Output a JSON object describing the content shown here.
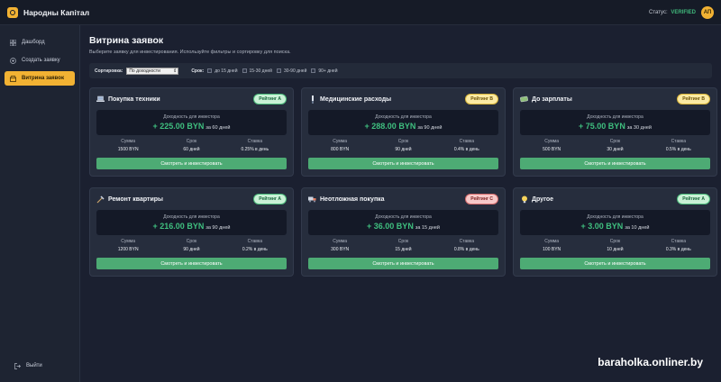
{
  "app": {
    "brand": "Народны Капітал",
    "status_label": "Статус:",
    "status_value": "VERIFIED",
    "avatar_initials": "АП",
    "accent_color": "#f2b233"
  },
  "sidebar": {
    "items": [
      {
        "label": "Дашборд",
        "icon": "grid-icon"
      },
      {
        "label": "Создать заявку",
        "icon": "plus-circle-icon"
      },
      {
        "label": "Витрина заявок",
        "icon": "storefront-icon",
        "active": true
      }
    ],
    "logout_label": "Выйти"
  },
  "page": {
    "title": "Витрина заявок",
    "subtitle": "Выберите заявку для инвестирования. Используйте фильтры и сортировку для поиска."
  },
  "filters": {
    "sort_label": "Сортировка:",
    "sort_value": "По доходности",
    "term_label": "Срок:",
    "term_options": [
      "до 15 дней",
      "15-30 дней",
      "30-90 дней",
      "90+ дней"
    ]
  },
  "cards": [
    {
      "title": "Покупка техники",
      "icon": "laptop-icon",
      "rating": "Рейтинг A",
      "yield_label": "Доходность для инвестора",
      "yield_amount": "+ 225.00 BYN",
      "yield_term": "за 60 дней",
      "sum_label": "Сумма",
      "sum": "1500 BYN",
      "term_label": "Срок",
      "term": "60 дней",
      "rate_label": "Ставка",
      "rate": "0.25% в день",
      "cta": "Смотреть и инвестировать"
    },
    {
      "title": "Медицинские расходы",
      "icon": "medical-icon",
      "rating": "Рейтинг B",
      "yield_label": "Доходность для инвестора",
      "yield_amount": "+ 288.00 BYN",
      "yield_term": "за 90 дней",
      "sum_label": "Сумма",
      "sum": "800 BYN",
      "term_label": "Срок",
      "term": "90 дней",
      "rate_label": "Ставка",
      "rate": "0.4% в день",
      "cta": "Смотреть и инвестировать"
    },
    {
      "title": "До зарплаты",
      "icon": "money-icon",
      "rating": "Рейтинг B",
      "yield_label": "Доходность для инвестора",
      "yield_amount": "+ 75.00 BYN",
      "yield_term": "за 30 дней",
      "sum_label": "Сумма",
      "sum": "500 BYN",
      "term_label": "Срок",
      "term": "30 дней",
      "rate_label": "Ставка",
      "rate": "0.5% в день",
      "cta": "Смотреть и инвестировать"
    },
    {
      "title": "Ремонт квартиры",
      "icon": "tools-icon",
      "rating": "Рейтинг A",
      "yield_label": "Доходность для инвестора",
      "yield_amount": "+ 216.00 BYN",
      "yield_term": "за 90 дней",
      "sum_label": "Сумма",
      "sum": "1200 BYN",
      "term_label": "Срок",
      "term": "90 дней",
      "rate_label": "Ставка",
      "rate": "0.2% в день",
      "cta": "Смотреть и инвестировать"
    },
    {
      "title": "Неотложная покупка",
      "icon": "truck-icon",
      "rating": "Рейтинг C",
      "yield_label": "Доходность для инвестора",
      "yield_amount": "+ 36.00 BYN",
      "yield_term": "за 15 дней",
      "sum_label": "Сумма",
      "sum": "300 BYN",
      "term_label": "Срок",
      "term": "15 дней",
      "rate_label": "Ставка",
      "rate": "0.8% в день",
      "cta": "Смотреть и инвестировать"
    },
    {
      "title": "Другое",
      "icon": "lightbulb-icon",
      "rating": "Рейтинг A",
      "yield_label": "Доходность для инвестора",
      "yield_amount": "+ 3.00 BYN",
      "yield_term": "за 10 дней",
      "sum_label": "Сумма",
      "sum": "100 BYN",
      "term_label": "Срок",
      "term": "10 дней",
      "rate_label": "Ставка",
      "rate": "0.3% в день",
      "cta": "Смотреть и инвестировать"
    }
  ],
  "watermark": "baraholka.onliner.by"
}
